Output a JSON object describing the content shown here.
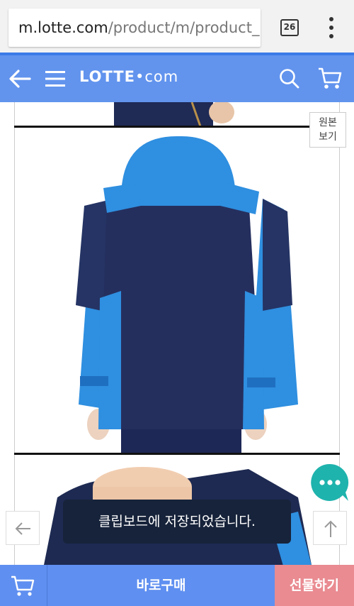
{
  "browser": {
    "url_host": "m.lotte.com",
    "url_path": "/product/m/product_",
    "tab_count": "26"
  },
  "header": {
    "logo_left": "LOTTE",
    "logo_dot": "•",
    "logo_right": "com"
  },
  "product": {
    "original_view_line1": "원본",
    "original_view_line2": "보기"
  },
  "toast": {
    "message": "클립보드에 저장되었습니다."
  },
  "bottom_bar": {
    "buy_now": "바로구매",
    "gift": "선물하기"
  },
  "colors": {
    "header_blue": "#6294ee",
    "buy_blue": "#5f8ff0",
    "gift_pink": "#e98b91",
    "chat_teal": "#1fb3ad",
    "toast_bg": "#17233a"
  }
}
